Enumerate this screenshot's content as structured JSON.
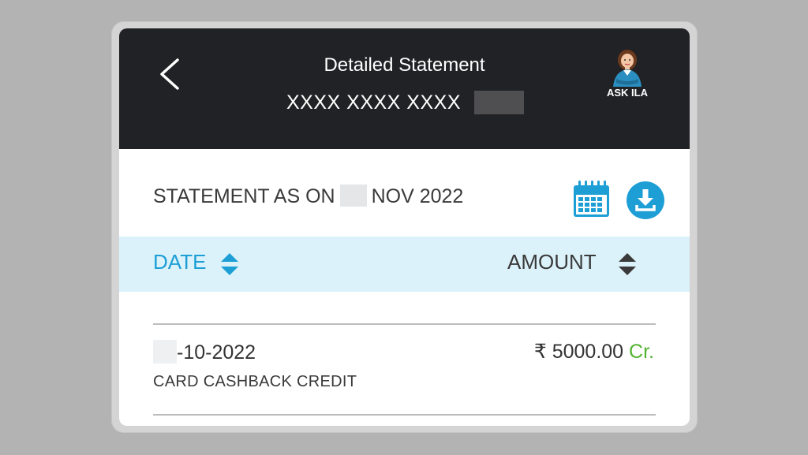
{
  "header": {
    "title": "Detailed Statement",
    "card_number": "XXXX XXXX XXXX",
    "assistant_label": "ASK ILA"
  },
  "statement": {
    "prefix": "STATEMENT AS ON",
    "month_year": "NOV 2022"
  },
  "table": {
    "date_header": "DATE",
    "amount_header": "AMOUNT"
  },
  "transactions": [
    {
      "date": "-10-2022",
      "description": "CARD CASHBACK CREDIT",
      "amount": "₹ 5000.00",
      "type": "Cr."
    }
  ],
  "colors": {
    "header_bg": "#212225",
    "accent": "#1d9fd6",
    "sort_bar_bg": "#dcf2fa",
    "credit": "#53b22f"
  },
  "icons": [
    "back-arrow-icon",
    "ask-ila-avatar-icon",
    "calendar-icon",
    "download-icon",
    "sort-icon"
  ]
}
